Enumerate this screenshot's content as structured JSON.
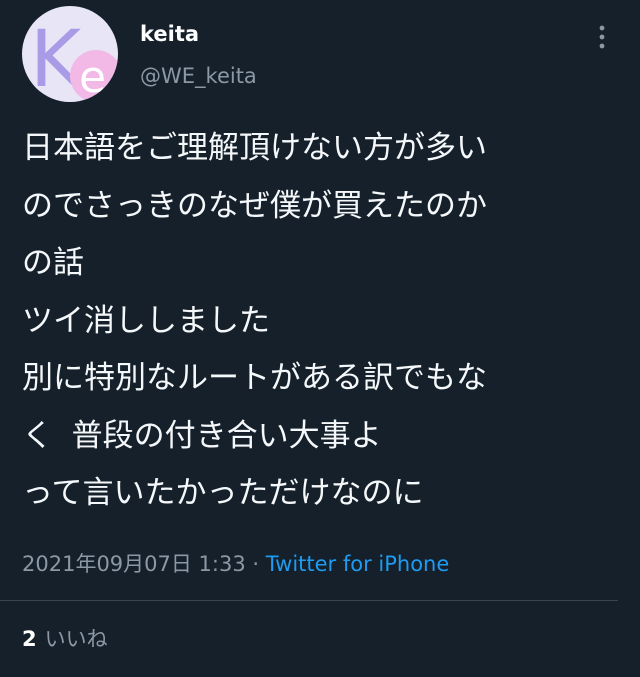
{
  "user": {
    "display_name": "keita",
    "handle": "@WE_keita",
    "avatar_text": "Ke"
  },
  "tweet": {
    "text": "日本語をご理解頂けない方が多い\nのでさっきのなぜ僕が買えたのか\nの話\nツイ消ししました\n別に特別なルートがある訳でもな\nく 普段の付き合い大事よ\nって言いたかっただけなのに",
    "timestamp": "2021年09月07日 1:33",
    "separator": "·",
    "source": "Twitter for iPhone"
  },
  "stats": {
    "likes_count": "2",
    "likes_label": "いいね"
  },
  "colors": {
    "background": "#15202b",
    "accent": "#1d9bf0",
    "muted": "#8b98a5",
    "avatar_bg": "#e8e6f6",
    "avatar_letter": "#a99be6",
    "avatar_circle": "#f2b8e6"
  },
  "icons": {
    "more": "vertical-ellipsis-icon"
  }
}
